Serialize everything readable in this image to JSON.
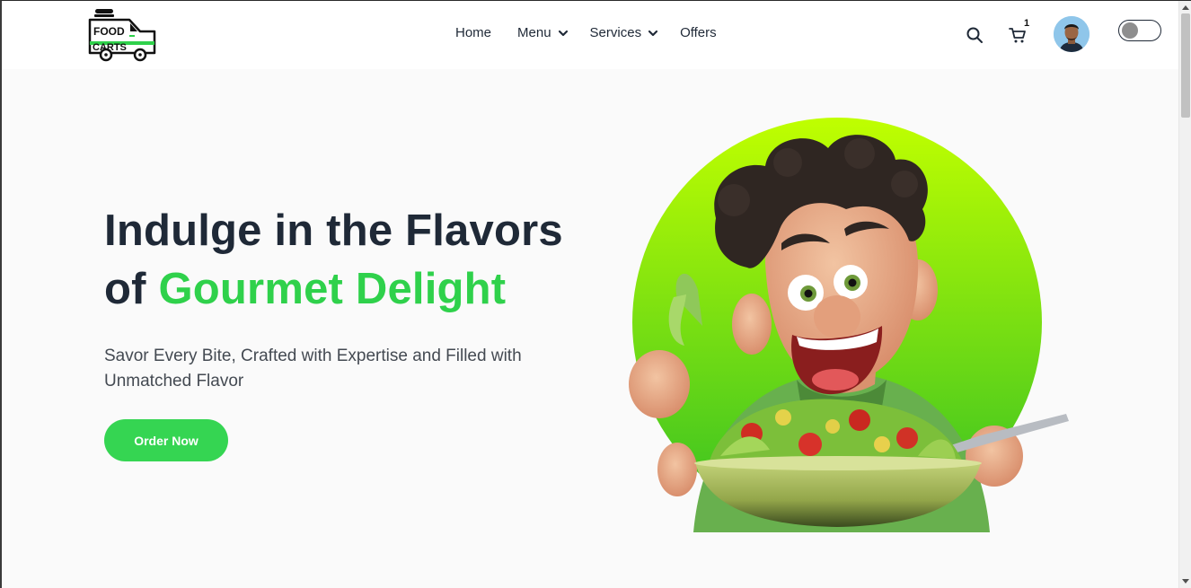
{
  "brand": {
    "logo_text_1": "FOOD",
    "logo_text_2": "CARTS"
  },
  "nav": {
    "items": [
      {
        "label": "Home",
        "dropdown": false
      },
      {
        "label": "Menu",
        "dropdown": true
      },
      {
        "label": "Services",
        "dropdown": true
      },
      {
        "label": "Offers",
        "dropdown": false
      }
    ]
  },
  "actions": {
    "search_icon": "search-icon",
    "cart_icon": "cart-icon",
    "cart_count": "1",
    "theme_toggle": "off"
  },
  "hero": {
    "title_line1": "Indulge in the Flavors",
    "title_line2_prefix": "of ",
    "title_line2_accent": "Gourmet Delight",
    "subtitle": "Savor Every Bite, Crafted with Expertise and Filled with Unmatched Flavor",
    "cta_label": "Order Now"
  },
  "colors": {
    "accent": "#2fd14b",
    "button": "#35d552",
    "heading": "#1f2937",
    "circle_top": "#c0ff00",
    "circle_bottom": "#33bf24"
  }
}
